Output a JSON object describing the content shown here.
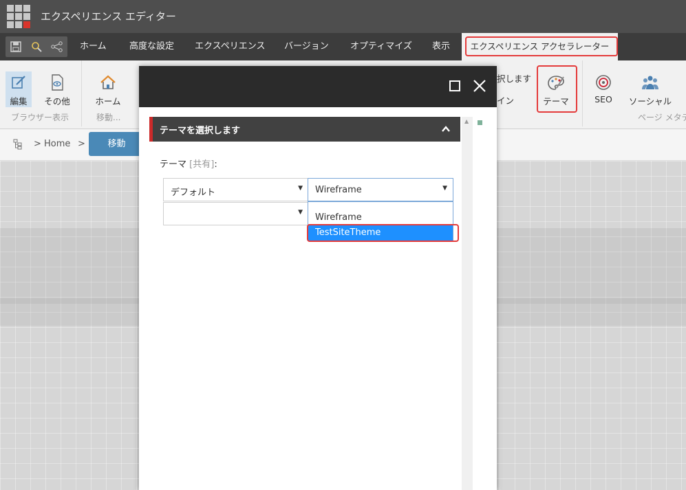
{
  "app": {
    "title": "エクスペリエンス エディター"
  },
  "ribbon_tabs": [
    {
      "label": "ホーム"
    },
    {
      "label": "高度な設定"
    },
    {
      "label": "エクスペリエンス"
    },
    {
      "label": "バージョン"
    },
    {
      "label": "オプティマイズ"
    },
    {
      "label": "表示"
    },
    {
      "label": "エクスペリエンス アクセラレーター"
    }
  ],
  "ribbon": {
    "edit_label": "編集",
    "other_label": "その他",
    "group_browser": "ブラウザー表示",
    "home_label": "ホーム",
    "group_move": "移動...",
    "partial_line1": "択します",
    "partial_line2": "イン",
    "theme_label": "テーマ",
    "seo_label": "SEO",
    "social_label": "ソーシャル",
    "group_page_meta": "ページ メタデ"
  },
  "breadcrumb": {
    "separator": ">",
    "home": "Home",
    "move_button": "移動"
  },
  "dialog": {
    "section_title": "テーマを選択します",
    "field_label": "テーマ",
    "field_shared": "[共有]",
    "field_colon": ":",
    "select1_value": "デフォルト",
    "select2_value": "Wireframe",
    "select3_value": "",
    "options": [
      "Wireframe",
      "TestSiteTheme"
    ],
    "selected_option": "TestSiteTheme"
  },
  "colors": {
    "titlebar": "#4e4e4e",
    "tabsbar": "#3c3c3c",
    "highlight": "#e43a3a",
    "selection": "#1e90ff",
    "move_button": "#4a89b7"
  }
}
